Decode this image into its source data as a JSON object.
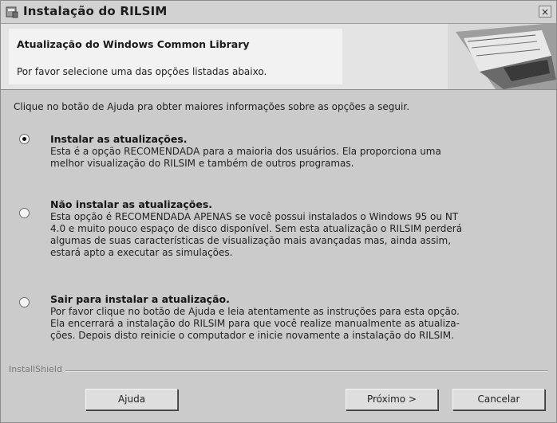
{
  "window": {
    "title": "Instalação do RILSIM",
    "close_glyph": "×",
    "app_icon": "installer-icon"
  },
  "header": {
    "title": "Atualização do Windows Common Library",
    "subtitle": "Por favor selecione uma das opções listadas abaixo.",
    "graphic_icon": "installshield-banner"
  },
  "intro": "Clique no botão de Ajuda pra obter maiores informações sobre as opções a seguir.",
  "options": [
    {
      "title": "Instalar as atualizações.",
      "description": "Esta é a opção RECOMENDADA para a maioria dos usuários. Ela proporciona uma\nmelhor visualização do RILSIM e também de outros programas.",
      "selected": true
    },
    {
      "title": "Não instalar as atualizações.",
      "description": "Esta opção é RECOMENDADA APENAS se você possui instalados o Windows 95 ou NT\n4.0 e muito pouco espaço de disco disponível. Sem esta atualização o RILSIM perderá\nalgumas de suas características de visualização mais avançadas mas, ainda assim,\nestará apto a executar as simulações.",
      "selected": false
    },
    {
      "title": "Sair para instalar a atualização.",
      "description": "Por favor clique no botão de Ajuda e leia atentamente as instruções para esta opção.\nEla encerrará a instalação do RILSIM para que você realize manualmente as atualiza-\nções. Depois disto reinicie o computador e inicie novamente a instalação do RILSIM.",
      "selected": false
    }
  ],
  "footer": {
    "brand": "InstallShield",
    "help_label": "Ajuda",
    "next_label": "Próximo >",
    "cancel_label": "Cancelar"
  }
}
